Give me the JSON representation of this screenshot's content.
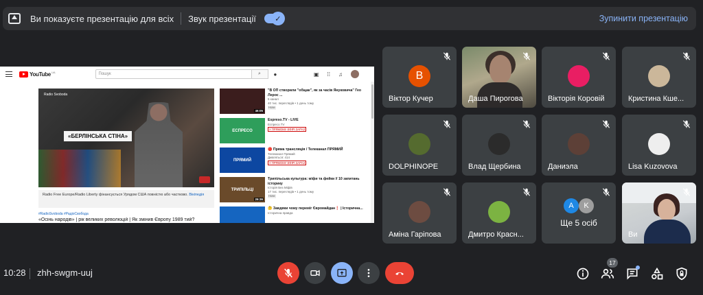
{
  "banner": {
    "presenting_text": "Ви показуєте презентацію для всіх",
    "sound_label": "Звук презентації",
    "sound_on": true,
    "stop_label": "Зупинити презентацію"
  },
  "youtube": {
    "logo_text": "YouTube",
    "logo_region": "UA",
    "search_placeholder": "Пошук",
    "video_logo": "Radio Svoboda",
    "video_caption": "«БЕРЛІНСЬКА СТІНА»",
    "disclaimer": "Radio Free Europe/Radio Liberty фінансується Урядом США повністю або частково.",
    "disclaimer_more": "Вікіпедія",
    "hashtags": "#RadioSvoboda #РадіоСвобода",
    "video_title": "«Осінь народів» | рік великих революцій | Як змінив Європу 1989 тий?",
    "recommendations": [
      {
        "thumb_text": "",
        "thumb_color": "#3b1d1d",
        "duration": "46:05",
        "title": "\"В ОП створили \"общак\", як за часів Януковича\" Гео Лерос ...",
        "channel": "5 канал",
        "meta": "40 тис. переглядів • 1 день тому",
        "tag": "Нове",
        "tag_type": "new"
      },
      {
        "thumb_text": "ЕСПРЕСО",
        "thumb_color": "#2e9e5b",
        "duration": "",
        "title": "Espreso.TV - LIVE",
        "channel": "Еспресо.TV",
        "meta": "",
        "tag": "У ПРЯМОМУ ЕФІРІ ЗАРАЗ",
        "tag_type": "live"
      },
      {
        "thumb_text": "ПРЯМИЙ",
        "thumb_color": "#0d47a1",
        "duration": "",
        "title": "🔴 Пряма трансляція / Телеканал ПРЯМИЙ",
        "channel": "Телеканал Прямий",
        "meta": "Дивляться: 414",
        "tag": "У ПРЯМОМУ ЕФІРІ ЗАРАЗ",
        "tag_type": "live"
      },
      {
        "thumb_text": "ТРИПІЛЬЦІ",
        "thumb_color": "#6a4a2a",
        "duration": "26:36",
        "title": "Трипільська культура: міфи та фейки // 10 запитань історику",
        "channel": "Історія Без Міфів",
        "meta": "17 тис. переглядів • 1 день тому",
        "tag": "Нове",
        "tag_type": "new"
      },
      {
        "thumb_text": "",
        "thumb_color": "#1565c0",
        "duration": "",
        "title": "🤔 Завдяки чому переміг Євромайдан❗ | Історична...",
        "channel": "Історична правда",
        "meta": "",
        "tag": "",
        "tag_type": ""
      }
    ]
  },
  "participants": [
    {
      "name": "Віктор Кучер",
      "initial": "B",
      "avatar_color": "#e65100",
      "kind": "initial"
    },
    {
      "name": "Даша Пирогова",
      "initial": "",
      "avatar_color": "",
      "kind": "video"
    },
    {
      "name": "Вікторія Коровій",
      "initial": "",
      "avatar_color": "#e91e63",
      "kind": "photo"
    },
    {
      "name": "Кристина Кше...",
      "initial": "",
      "avatar_color": "#cbb79a",
      "kind": "photo"
    },
    {
      "name": "DOLPHINOPE",
      "initial": "",
      "avatar_color": "#556b2f",
      "kind": "photo"
    },
    {
      "name": "Влад Щербина",
      "initial": "",
      "avatar_color": "#2b2b2b",
      "kind": "photo"
    },
    {
      "name": "Даниэла",
      "initial": "",
      "avatar_color": "#5d4037",
      "kind": "photo"
    },
    {
      "name": "Lisa Kuzovova",
      "initial": "",
      "avatar_color": "#eeeeee",
      "kind": "photo"
    },
    {
      "name": "Аміна Гаріпова",
      "initial": "",
      "avatar_color": "#6d4c41",
      "kind": "photo"
    },
    {
      "name": "Дмитро Красн...",
      "initial": "",
      "avatar_color": "#7cb342",
      "kind": "photo"
    }
  ],
  "more_tile": {
    "label": "Ще 5 осіб",
    "avatars": [
      {
        "initial": "A",
        "color": "#1e88e5"
      },
      {
        "initial": "K",
        "color": "#9e9e9e"
      }
    ]
  },
  "self_tile": {
    "name": "Ви"
  },
  "bottom_bar": {
    "time": "10:28",
    "meeting_code": "zhh-swgm-uuj",
    "participants_count": "17"
  },
  "colors": {
    "danger": "#ea4335",
    "accent": "#8ab4f8",
    "tile_bg": "#3c4043"
  }
}
